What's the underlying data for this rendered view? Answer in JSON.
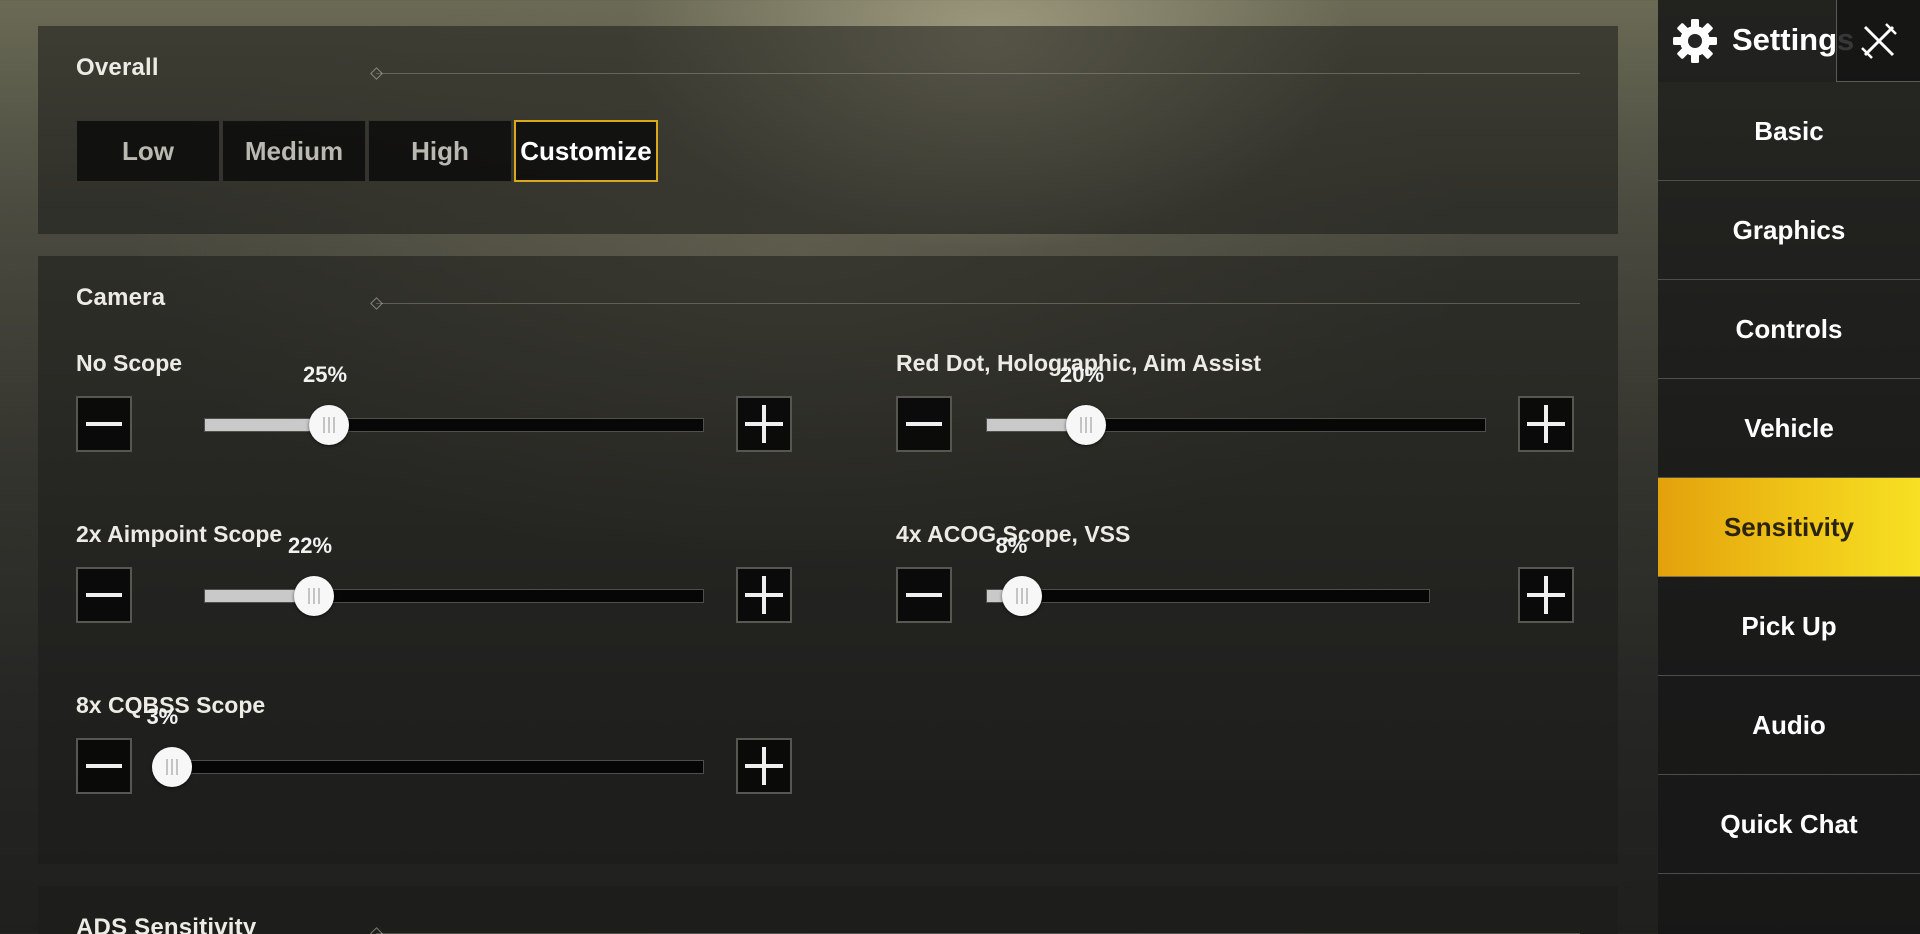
{
  "overall": {
    "title": "Overall",
    "presets": [
      {
        "label": "Low",
        "active": false
      },
      {
        "label": "Medium",
        "active": false
      },
      {
        "label": "High",
        "active": false
      },
      {
        "label": "Customize",
        "active": true
      }
    ]
  },
  "camera": {
    "title": "Camera",
    "settings": [
      {
        "label": "No Scope",
        "value_text": "25%",
        "value": 0.25
      },
      {
        "label": "Red Dot, Holographic, Aim Assist",
        "value_text": "20%",
        "value": 0.2
      },
      {
        "label": "2x Aimpoint Scope",
        "value_text": "22%",
        "value": 0.22
      },
      {
        "label": "4x ACOG Scope, VSS",
        "value_text": "8%",
        "value": 0.08
      },
      {
        "label": "8x CQBSS Scope",
        "value_text": "3%",
        "value": 0.03
      }
    ]
  },
  "ads": {
    "title": "ADS Sensitivity"
  },
  "sidebar": {
    "title": "Settings",
    "items": [
      {
        "label": "Basic",
        "active": false
      },
      {
        "label": "Graphics",
        "active": false
      },
      {
        "label": "Controls",
        "active": false
      },
      {
        "label": "Vehicle",
        "active": false
      },
      {
        "label": "Sensitivity",
        "active": true
      },
      {
        "label": "Pick Up",
        "active": false
      },
      {
        "label": "Audio",
        "active": false
      },
      {
        "label": "Quick Chat",
        "active": false
      }
    ]
  },
  "colors": {
    "accent": "#f0c617",
    "active_border": "#d9a91a"
  },
  "icons": {
    "settings": "gear-icon",
    "close": "close-icon",
    "decrease": "minus-icon",
    "increase": "plus-icon"
  }
}
